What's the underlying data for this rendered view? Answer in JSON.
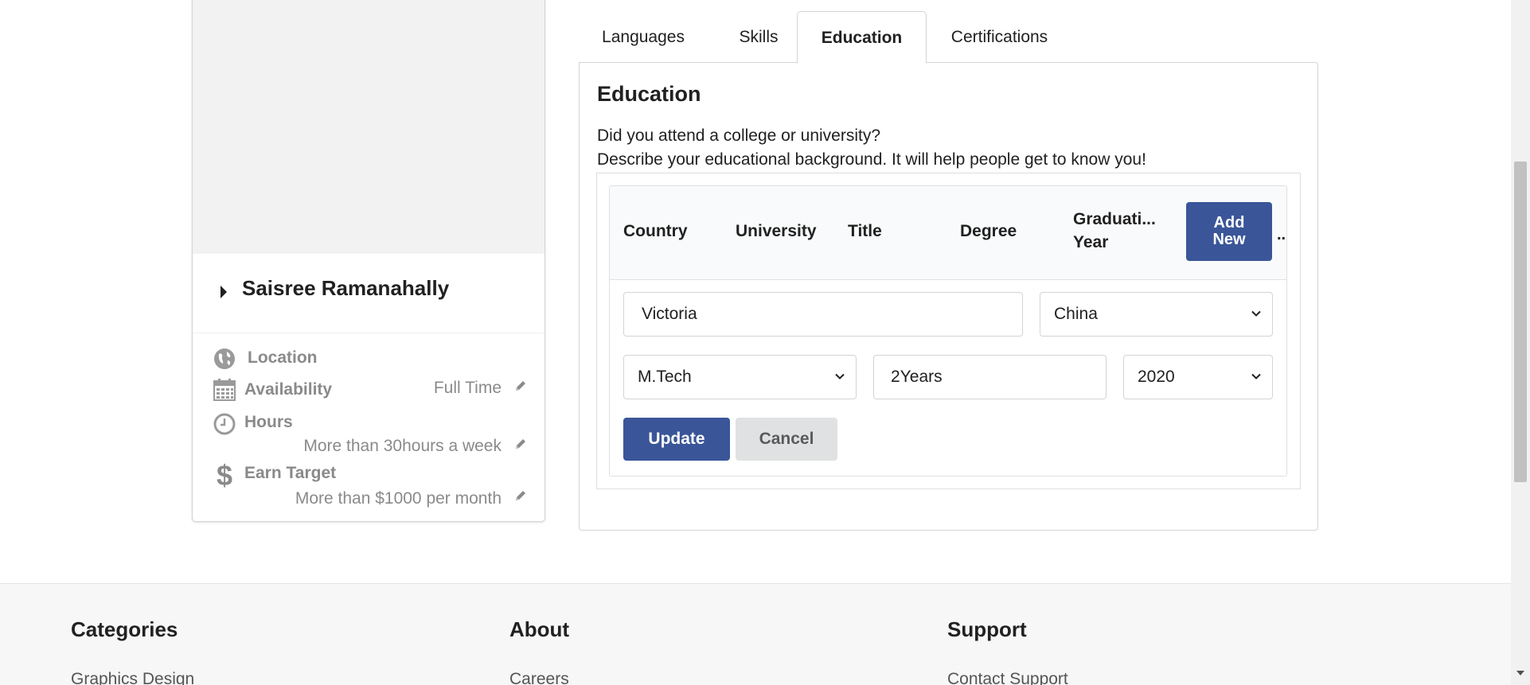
{
  "profile": {
    "name": "Saisree Ramanahally",
    "location_label": "Location",
    "availability_label": "Availability",
    "availability_value": "Full Time",
    "hours_label": "Hours",
    "hours_value": "More than 30hours a week",
    "earn_label": "Earn Target",
    "earn_value": "More than $1000 per month"
  },
  "tabs": [
    {
      "label": "Languages"
    },
    {
      "label": "Skills"
    },
    {
      "label": "Education"
    },
    {
      "label": "Certifications"
    }
  ],
  "education": {
    "title": "Education",
    "question": "Did you attend a college or university?",
    "description": "Describe your educational background. It will help people get to know you!",
    "columns": [
      "Country",
      "University",
      "Title",
      "Degree",
      "Graduati...",
      "Year"
    ],
    "add_new_line1": "Add",
    "add_new_line2": "New",
    "more": "..",
    "form": {
      "university_value": "Victoria",
      "country_value": "China",
      "title_value": "M.Tech",
      "degree_value": "2Years",
      "year_value": "2020",
      "update_label": "Update",
      "cancel_label": "Cancel"
    }
  },
  "footer": {
    "categories_heading": "Categories",
    "about_heading": "About",
    "support_heading": "Support",
    "categories_link": "Graphics Design",
    "about_link": "Careers",
    "support_link": "Contact Support"
  },
  "colors": {
    "primary": "#3a5699",
    "cancel_bg": "#e0e1e2",
    "muted_text": "#8a8a8a"
  }
}
